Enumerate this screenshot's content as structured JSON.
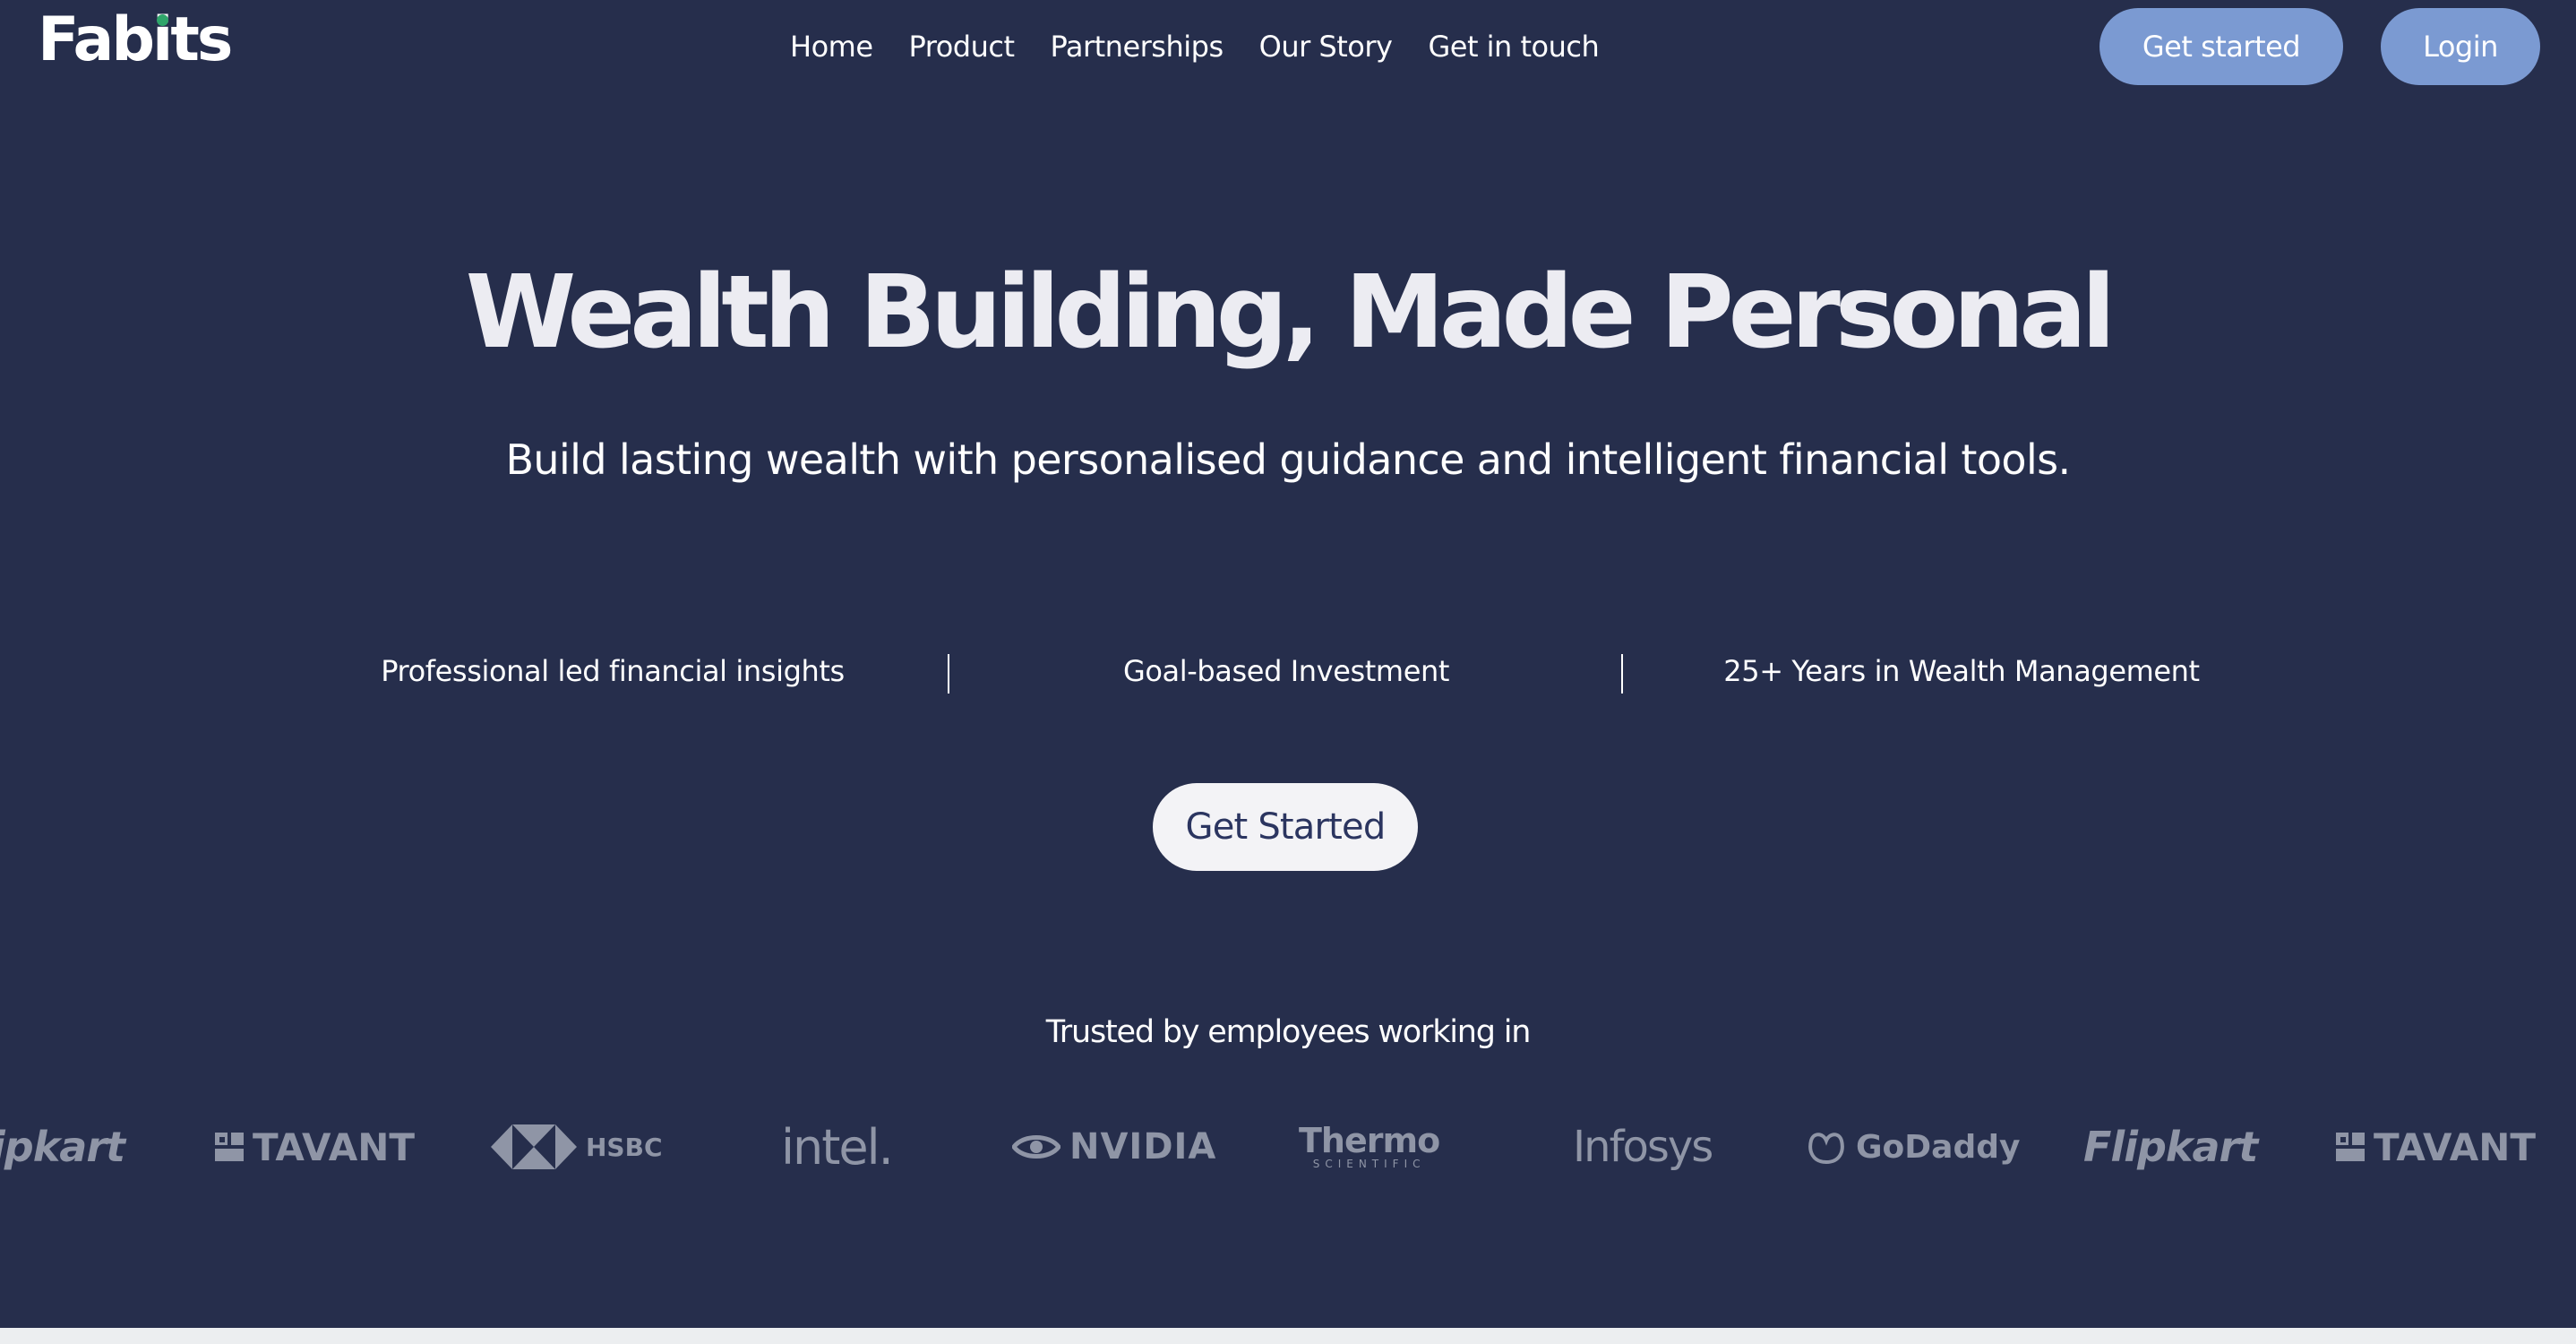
{
  "header": {
    "logo_text": "Fabits",
    "nav": [
      "Home",
      "Product",
      "Partnerships",
      "Our Story",
      "Get in touch"
    ],
    "get_started_label": "Get started",
    "login_label": "Login",
    "accent_color": "#7b9ad2",
    "logo_dot_color": "#2fa56a"
  },
  "hero": {
    "title": "Wealth Building, Made Personal",
    "subtitle": "Build lasting wealth with personalised guidance and intelligent financial tools.",
    "features": [
      "Professional led financial insights",
      "Goal-based Investment",
      "25+ Years in Wealth Management"
    ],
    "cta_label": "Get Started",
    "background_color": "#262e4c"
  },
  "trusted": {
    "heading": "Trusted by employees working in",
    "logos": [
      {
        "name": "Flipkart",
        "text": "ipkart"
      },
      {
        "name": "Tavant",
        "text": "TAVANT"
      },
      {
        "name": "HSBC",
        "text": "HSBC"
      },
      {
        "name": "Intel",
        "text": "intel."
      },
      {
        "name": "NVIDIA",
        "text": "NVIDIA"
      },
      {
        "name": "Thermo Scientific",
        "text": "Thermo",
        "subtext": "SCIENTIFIC"
      },
      {
        "name": "Infosys",
        "text": "Infosys"
      },
      {
        "name": "GoDaddy",
        "text": "GoDaddy"
      },
      {
        "name": "Flipkart",
        "text": "Flipkart"
      },
      {
        "name": "Tavant",
        "text": "TAVANT"
      }
    ]
  }
}
